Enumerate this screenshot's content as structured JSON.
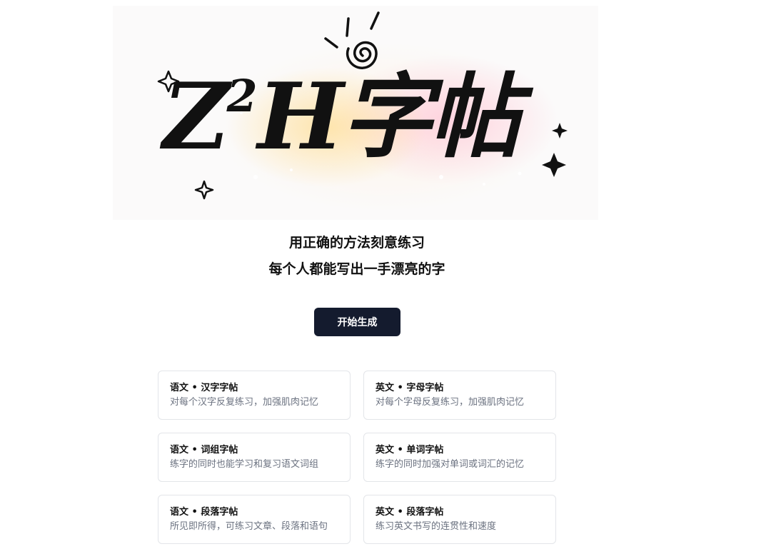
{
  "hero": {
    "logo_main": "Z",
    "logo_sup": "2",
    "logo_rest": "H字帖"
  },
  "tagline": {
    "line1": "用正确的方法刻意练习",
    "line2": "每个人都能写出一手漂亮的字"
  },
  "cta": {
    "label": "开始生成"
  },
  "cards": [
    {
      "title": "语文 • 汉字字帖",
      "desc": "对每个汉字反复练习，加强肌肉记忆"
    },
    {
      "title": "英文 • 字母字帖",
      "desc": "对每个字母反复练习，加强肌肉记忆"
    },
    {
      "title": "语文 • 词组字帖",
      "desc": "练字的同时也能学习和复习语文词组"
    },
    {
      "title": "英文 • 单词字帖",
      "desc": "练字的同时加强对单词或词汇的记忆"
    },
    {
      "title": "语文 • 段落字帖",
      "desc": "所见即所得，可练习文章、段落和语句"
    },
    {
      "title": "英文 • 段落字帖",
      "desc": "练习英文书写的连贯性和速度"
    }
  ],
  "icons": [
    "spiral-doodle-icon",
    "sparkle-icon"
  ]
}
